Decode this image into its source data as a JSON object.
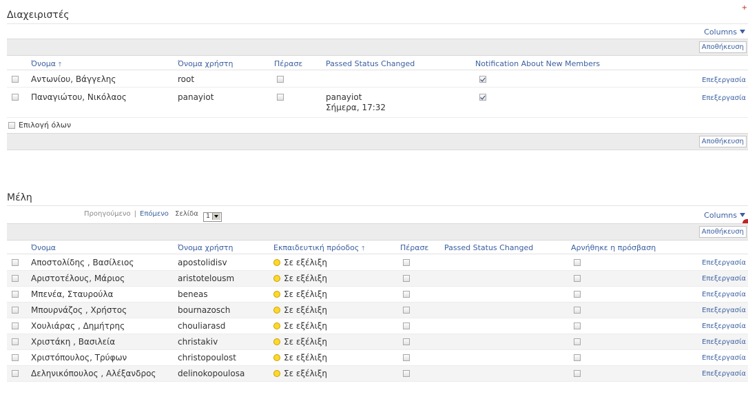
{
  "admins": {
    "title": "Διαχειριστές",
    "columns_label": "Columns",
    "save_label": "Αποθήκευση",
    "headers": [
      "Όνομα",
      "Όνομα χρήστη",
      "Πέρασε",
      "Passed Status Changed",
      "Notification About New Members"
    ],
    "rows": [
      {
        "name": "Αντωνίου, Βάγγελης",
        "username": "root",
        "passed": false,
        "changed_by": "",
        "changed_at": "",
        "notify": true,
        "edit": "Επεξεργασία"
      },
      {
        "name": "Παναγιώτου, Νικόλαος",
        "username": "panayiot",
        "passed": false,
        "changed_by": "panayiot",
        "changed_at": "Σήμερα, 17:32",
        "notify": true,
        "edit": "Επεξεργασία"
      }
    ],
    "select_all": "Επιλογή όλων"
  },
  "members": {
    "title": "Μέλη",
    "pager": {
      "prev": "Προηγούμενο",
      "sep": "|",
      "next": "Επόμενο",
      "page_label": "Σελίδα",
      "page": "1"
    },
    "columns_label": "Columns",
    "save_label": "Αποθήκευση",
    "headers": [
      "Όνομα",
      "Όνομα χρήστη",
      "Εκπαιδευτική πρόοδος",
      "Πέρασε",
      "Passed Status Changed",
      "Αρνήθηκε η πρόσβαση"
    ],
    "rows": [
      {
        "name": "Αποστολίδης , Βασίλειος",
        "username": "apostolidisv",
        "progress": "Σε εξέλιξη",
        "edit": "Επεξεργασία"
      },
      {
        "name": "Αριστοτέλους, Μάριος",
        "username": "aristotelousm",
        "progress": "Σε εξέλιξη",
        "edit": "Επεξεργασία"
      },
      {
        "name": "Μπενέα, Σταυρούλα",
        "username": "beneas",
        "progress": "Σε εξέλιξη",
        "edit": "Επεξεργασία"
      },
      {
        "name": "Μπουρνάζος , Χρήστος",
        "username": "bournazosch",
        "progress": "Σε εξέλιξη",
        "edit": "Επεξεργασία"
      },
      {
        "name": "Χουλιάρας , Δημήτρης",
        "username": "chouliarasd",
        "progress": "Σε εξέλιξη",
        "edit": "Επεξεργασία"
      },
      {
        "name": "Χριστάκη , Βασιλεία",
        "username": "christakiv",
        "progress": "Σε εξέλιξη",
        "edit": "Επεξεργασία"
      },
      {
        "name": "Χριστόπουλος, Τρύφων",
        "username": "christopoulost",
        "progress": "Σε εξέλιξη",
        "edit": "Επεξεργασία"
      },
      {
        "name": "Δεληνικόπουλος , Αλέξανδρος",
        "username": "delinokopoulosa",
        "progress": "Σε εξέλιξη",
        "edit": "Επεξεργασία"
      }
    ]
  },
  "icons": {
    "sort_up": "sort-ascending-icon",
    "dropdown": "caret-down-icon",
    "progress": "in-progress-dot-icon"
  },
  "colors": {
    "link": "#3a5fa0",
    "progress_dot": "#ffd82a",
    "bar": "#ececec"
  }
}
